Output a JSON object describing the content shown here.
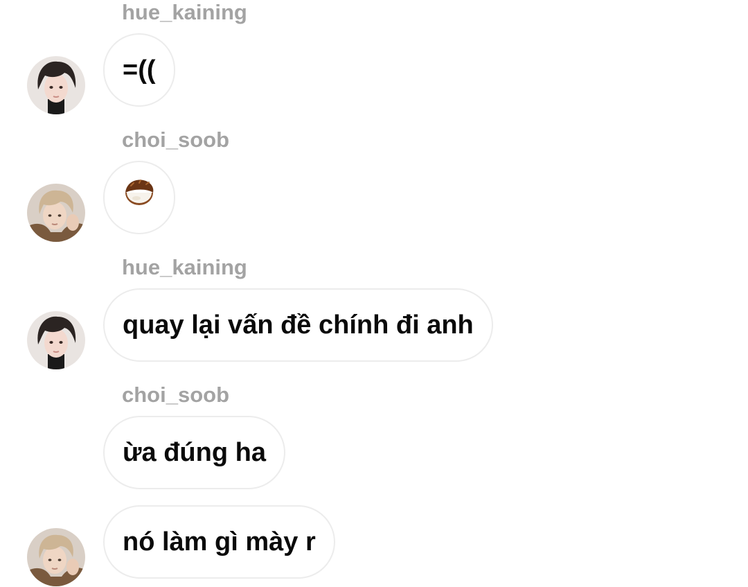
{
  "conversation": {
    "messages": [
      {
        "sender": "hue_kaining",
        "text": "=(("
      },
      {
        "sender": "choi_soob",
        "text": "🥥"
      },
      {
        "sender": "hue_kaining",
        "text": "quay lại vấn đề chính đi anh"
      },
      {
        "sender": "choi_soob",
        "text": "ừa đúng ha"
      },
      {
        "sender": "",
        "text": "nó làm gì mày r"
      }
    ]
  },
  "avatars": {
    "hue_kaining": {
      "hair": "#2b2422",
      "skin": "#f3d9cf",
      "background": "#e9e4e1"
    },
    "choi_soob": {
      "hair": "#cdb595",
      "skin": "#efd6c4",
      "jacket": "#7a5a3e",
      "background": "#d9cfc6"
    }
  },
  "icons": {
    "coconut": "coconut-emoji"
  },
  "colors": {
    "sender_name": "#a3a3a3",
    "bubble_border": "#ececec",
    "message_text": "#0a0a0a"
  }
}
